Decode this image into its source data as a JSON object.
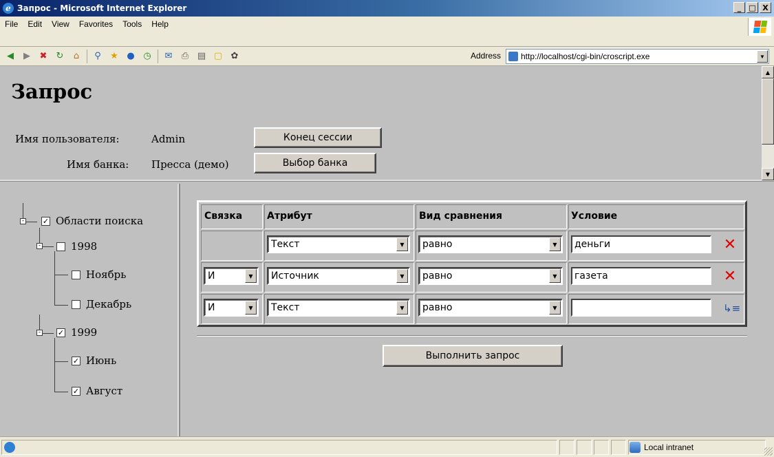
{
  "window": {
    "title": "Запрос - Microsoft Internet Explorer",
    "controls": [
      "_",
      "□",
      "X"
    ]
  },
  "menu": [
    "File",
    "Edit",
    "View",
    "Favorites",
    "Tools",
    "Help"
  ],
  "address": {
    "label": "Address",
    "url": "http://localhost/cgi-bin/croscript.exe"
  },
  "header": {
    "title": "Запрос",
    "user_label": "Имя пользователя:",
    "user_value": "Admin",
    "bank_label": "Имя банка:",
    "bank_value": "Пресса (демо)",
    "end_session_button": "Конец сессии",
    "select_bank_button": "Выбор банка"
  },
  "tree": {
    "items": [
      {
        "label": "Области поиска",
        "checked": true
      },
      {
        "label": "1998",
        "checked": false
      },
      {
        "label": "Ноябрь",
        "checked": false
      },
      {
        "label": "Декабрь",
        "checked": false
      },
      {
        "label": "1999",
        "checked": true
      },
      {
        "label": "Июнь",
        "checked": true
      },
      {
        "label": "Август",
        "checked": true
      }
    ]
  },
  "query": {
    "columns": [
      "Связка",
      "Атрибут",
      "Вид сравнения",
      "Условие"
    ],
    "rows": [
      {
        "link": "",
        "attribute": "Текст",
        "comparison": "равно",
        "condition": "деньги",
        "action": "delete-icon"
      },
      {
        "link": "И",
        "attribute": "Источник",
        "comparison": "равно",
        "condition": "газета",
        "action": "delete-icon"
      },
      {
        "link": "И",
        "attribute": "Текст",
        "comparison": "равно",
        "condition": "",
        "action": "add-row-icon"
      }
    ],
    "run_button": "Выполнить запрос"
  },
  "status": {
    "zone": "Local intranet"
  },
  "colors": {
    "titlebar": "#0a246a",
    "chrome": "#ece9d8",
    "page_bg": "#c0c0c0",
    "delete": "#e00000"
  }
}
